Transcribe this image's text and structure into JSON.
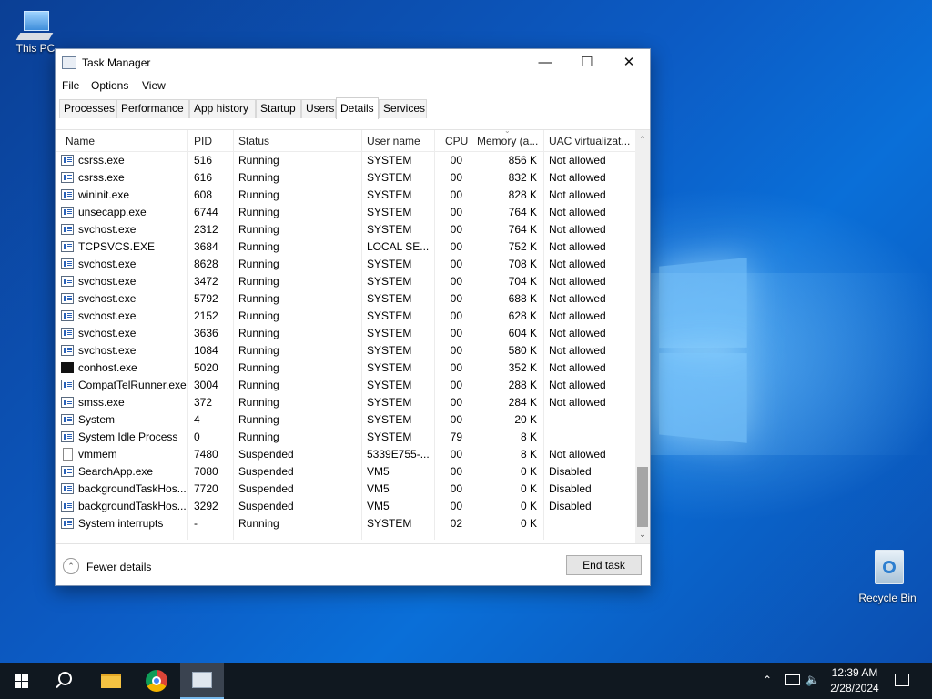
{
  "desktop": {
    "icons": [
      {
        "label": "This PC",
        "icon": "computer-icon"
      },
      {
        "label": "Recycle Bin",
        "icon": "recycle-bin-icon"
      }
    ]
  },
  "window": {
    "title": "Task Manager",
    "controls": {
      "minimize": "—",
      "maximize": "☐",
      "close": "✕"
    },
    "menu": [
      "File",
      "Options",
      "View"
    ],
    "tabs": [
      "Processes",
      "Performance",
      "App history",
      "Startup",
      "Users",
      "Details",
      "Services"
    ],
    "active_tab": "Details",
    "columns": [
      "Name",
      "PID",
      "Status",
      "User name",
      "CPU",
      "Memory (a...",
      "UAC virtualizat..."
    ],
    "rows": [
      {
        "name": "csrss.exe",
        "pid": "516",
        "status": "Running",
        "user": "SYSTEM",
        "cpu": "00",
        "memory": "856 K",
        "uac": "Not allowed",
        "icon": "process-icon"
      },
      {
        "name": "csrss.exe",
        "pid": "616",
        "status": "Running",
        "user": "SYSTEM",
        "cpu": "00",
        "memory": "832 K",
        "uac": "Not allowed",
        "icon": "process-icon"
      },
      {
        "name": "wininit.exe",
        "pid": "608",
        "status": "Running",
        "user": "SYSTEM",
        "cpu": "00",
        "memory": "828 K",
        "uac": "Not allowed",
        "icon": "process-icon"
      },
      {
        "name": "unsecapp.exe",
        "pid": "6744",
        "status": "Running",
        "user": "SYSTEM",
        "cpu": "00",
        "memory": "764 K",
        "uac": "Not allowed",
        "icon": "process-icon"
      },
      {
        "name": "svchost.exe",
        "pid": "2312",
        "status": "Running",
        "user": "SYSTEM",
        "cpu": "00",
        "memory": "764 K",
        "uac": "Not allowed",
        "icon": "process-icon"
      },
      {
        "name": "TCPSVCS.EXE",
        "pid": "3684",
        "status": "Running",
        "user": "LOCAL SE...",
        "cpu": "00",
        "memory": "752 K",
        "uac": "Not allowed",
        "icon": "process-icon"
      },
      {
        "name": "svchost.exe",
        "pid": "8628",
        "status": "Running",
        "user": "SYSTEM",
        "cpu": "00",
        "memory": "708 K",
        "uac": "Not allowed",
        "icon": "process-icon"
      },
      {
        "name": "svchost.exe",
        "pid": "3472",
        "status": "Running",
        "user": "SYSTEM",
        "cpu": "00",
        "memory": "704 K",
        "uac": "Not allowed",
        "icon": "process-icon"
      },
      {
        "name": "svchost.exe",
        "pid": "5792",
        "status": "Running",
        "user": "SYSTEM",
        "cpu": "00",
        "memory": "688 K",
        "uac": "Not allowed",
        "icon": "process-icon"
      },
      {
        "name": "svchost.exe",
        "pid": "2152",
        "status": "Running",
        "user": "SYSTEM",
        "cpu": "00",
        "memory": "628 K",
        "uac": "Not allowed",
        "icon": "process-icon"
      },
      {
        "name": "svchost.exe",
        "pid": "3636",
        "status": "Running",
        "user": "SYSTEM",
        "cpu": "00",
        "memory": "604 K",
        "uac": "Not allowed",
        "icon": "process-icon"
      },
      {
        "name": "svchost.exe",
        "pid": "1084",
        "status": "Running",
        "user": "SYSTEM",
        "cpu": "00",
        "memory": "580 K",
        "uac": "Not allowed",
        "icon": "process-icon"
      },
      {
        "name": "conhost.exe",
        "pid": "5020",
        "status": "Running",
        "user": "SYSTEM",
        "cpu": "00",
        "memory": "352 K",
        "uac": "Not allowed",
        "icon": "console-icon"
      },
      {
        "name": "CompatTelRunner.exe",
        "pid": "3004",
        "status": "Running",
        "user": "SYSTEM",
        "cpu": "00",
        "memory": "288 K",
        "uac": "Not allowed",
        "icon": "process-icon"
      },
      {
        "name": "smss.exe",
        "pid": "372",
        "status": "Running",
        "user": "SYSTEM",
        "cpu": "00",
        "memory": "284 K",
        "uac": "Not allowed",
        "icon": "process-icon"
      },
      {
        "name": "System",
        "pid": "4",
        "status": "Running",
        "user": "SYSTEM",
        "cpu": "00",
        "memory": "20 K",
        "uac": "",
        "icon": "process-icon"
      },
      {
        "name": "System Idle Process",
        "pid": "0",
        "status": "Running",
        "user": "SYSTEM",
        "cpu": "79",
        "memory": "8 K",
        "uac": "",
        "icon": "process-icon"
      },
      {
        "name": "vmmem",
        "pid": "7480",
        "status": "Suspended",
        "user": "5339E755-...",
        "cpu": "00",
        "memory": "8 K",
        "uac": "Not allowed",
        "icon": "document-icon"
      },
      {
        "name": "SearchApp.exe",
        "pid": "7080",
        "status": "Suspended",
        "user": "VM5",
        "cpu": "00",
        "memory": "0 K",
        "uac": "Disabled",
        "icon": "process-icon"
      },
      {
        "name": "backgroundTaskHos...",
        "pid": "7720",
        "status": "Suspended",
        "user": "VM5",
        "cpu": "00",
        "memory": "0 K",
        "uac": "Disabled",
        "icon": "process-icon"
      },
      {
        "name": "backgroundTaskHos...",
        "pid": "3292",
        "status": "Suspended",
        "user": "VM5",
        "cpu": "00",
        "memory": "0 K",
        "uac": "Disabled",
        "icon": "process-icon"
      },
      {
        "name": "System interrupts",
        "pid": "-",
        "status": "Running",
        "user": "SYSTEM",
        "cpu": "02",
        "memory": "0 K",
        "uac": "",
        "icon": "process-icon"
      }
    ],
    "footer": {
      "fewer_details": "Fewer details",
      "end_task": "End task"
    }
  },
  "taskbar": {
    "items": [
      "start-icon",
      "search-icon",
      "file-explorer-icon",
      "chrome-icon",
      "task-manager-icon"
    ],
    "time": "12:39 AM",
    "date": "2/28/2024"
  }
}
